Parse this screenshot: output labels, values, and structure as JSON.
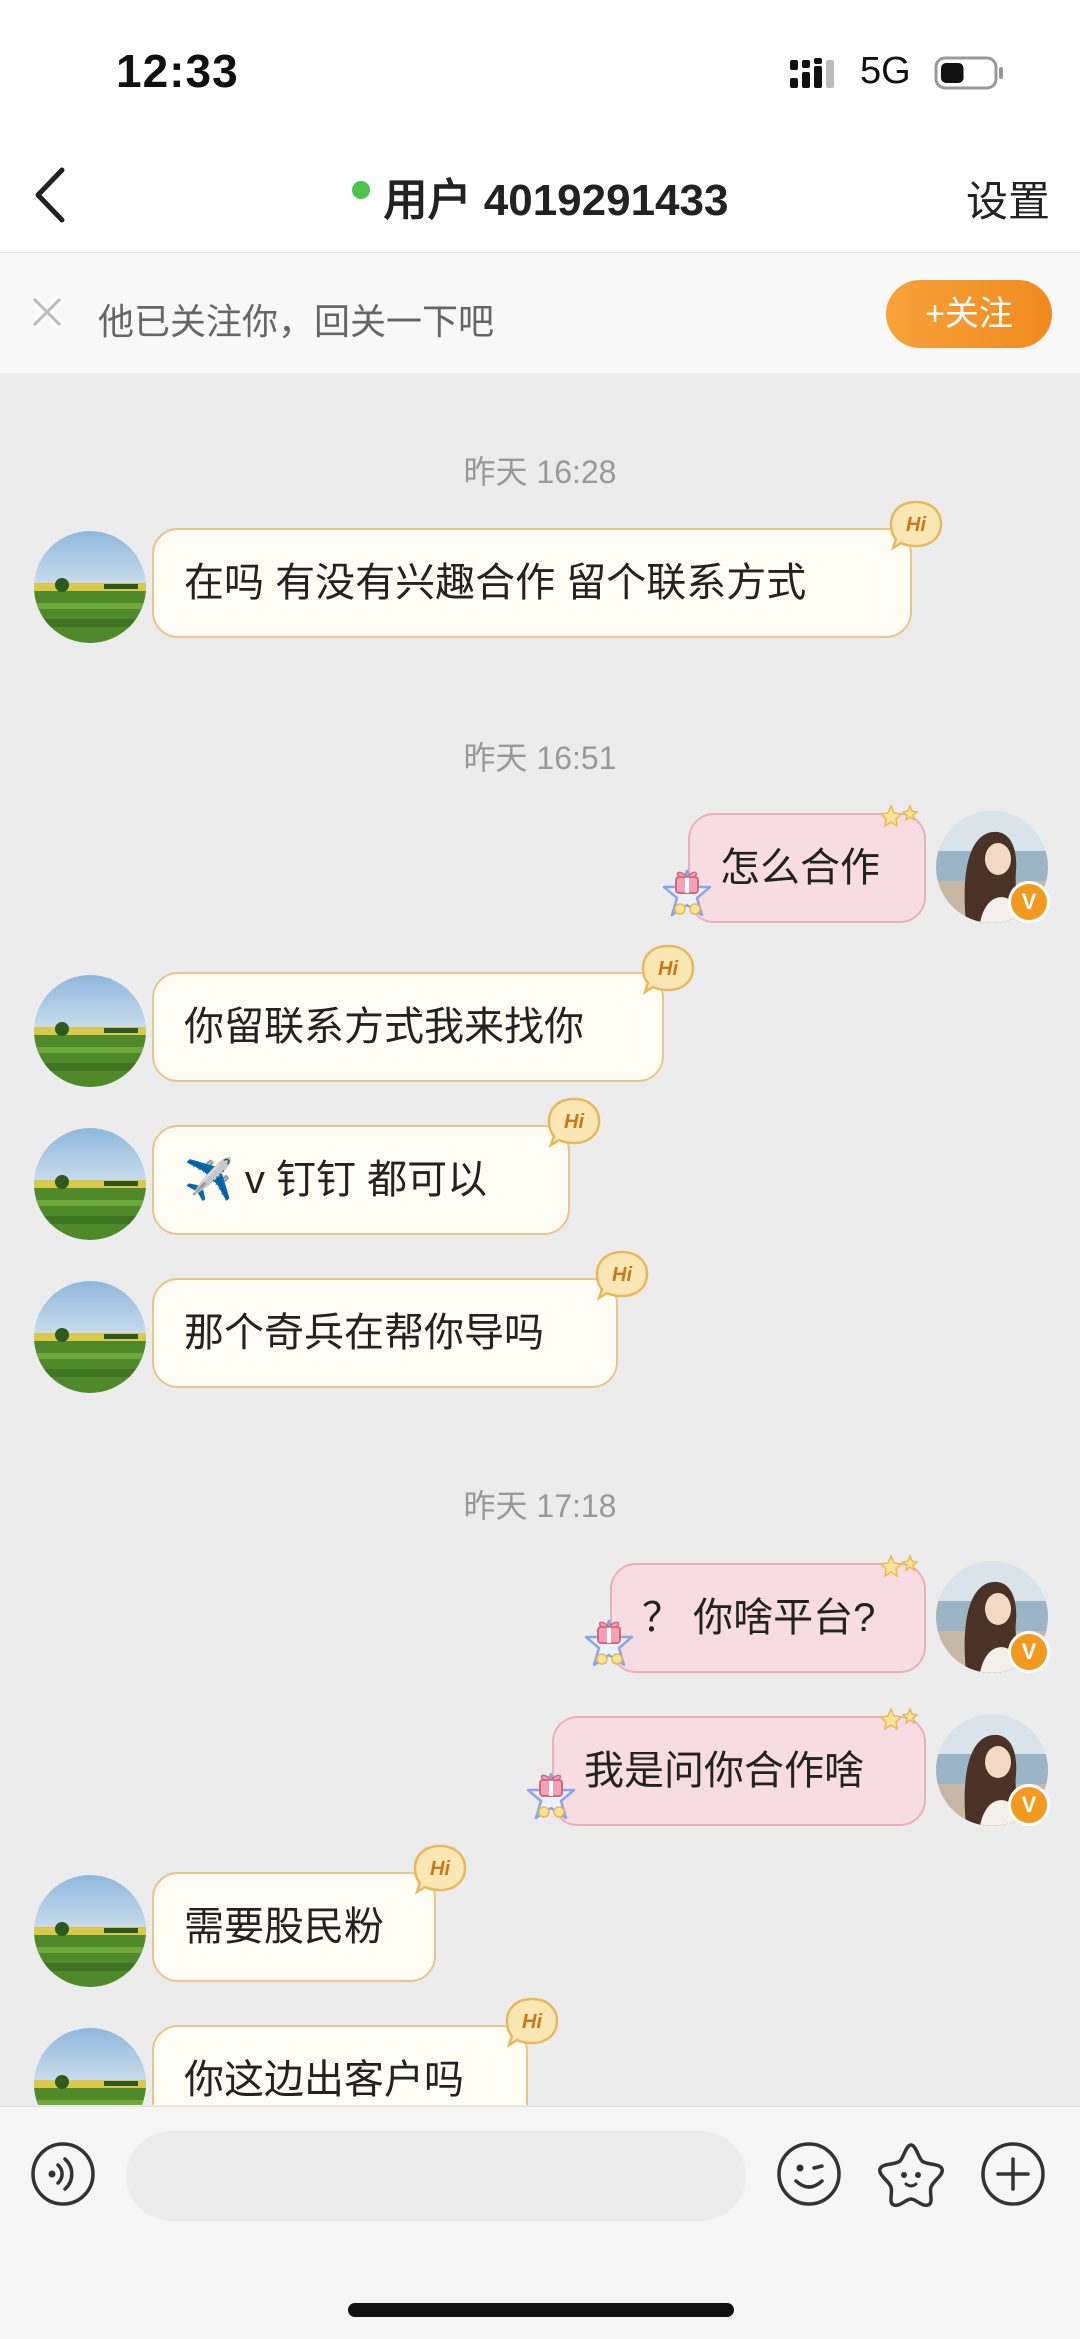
{
  "status_bar": {
    "time": "12:33",
    "network": "5G",
    "battery_level": 0.45
  },
  "header": {
    "title": "用户 4019291433",
    "settings_label": "设置",
    "online_color": "#4cc34c"
  },
  "follow_banner": {
    "text": "他已关注你，回关一下吧",
    "button_label": "+关注",
    "button_color": "#f39a2a"
  },
  "messages": [
    {
      "kind": "timestamp",
      "text": "昨天 16:28"
    },
    {
      "kind": "incoming",
      "text": "在吗 有没有兴趣合作 留个联系方式",
      "badge": "Hi"
    },
    {
      "kind": "timestamp",
      "text": "昨天 16:51"
    },
    {
      "kind": "outgoing",
      "text": "怎么合作",
      "avatar_badge": "V"
    },
    {
      "kind": "incoming",
      "text": "你留联系方式我来找你",
      "badge": "Hi"
    },
    {
      "kind": "incoming",
      "text": "✈️ v  钉钉 都可以",
      "badge": "Hi"
    },
    {
      "kind": "incoming",
      "text": "那个奇兵在帮你导吗",
      "badge": "Hi"
    },
    {
      "kind": "timestamp",
      "text": "昨天 17:18"
    },
    {
      "kind": "outgoing",
      "text": "？ 你啥平台?",
      "avatar_badge": "V"
    },
    {
      "kind": "outgoing",
      "text": "我是问你合作啥",
      "avatar_badge": "V"
    },
    {
      "kind": "incoming",
      "text": "需要股民粉",
      "badge": "Hi"
    },
    {
      "kind": "incoming",
      "text": "你这边出客户吗",
      "badge": "Hi"
    }
  ],
  "input_bar": {
    "icons": [
      "voice-icon",
      "emoji-icon",
      "sticker-icon",
      "plus-icon"
    ],
    "placeholder": ""
  }
}
